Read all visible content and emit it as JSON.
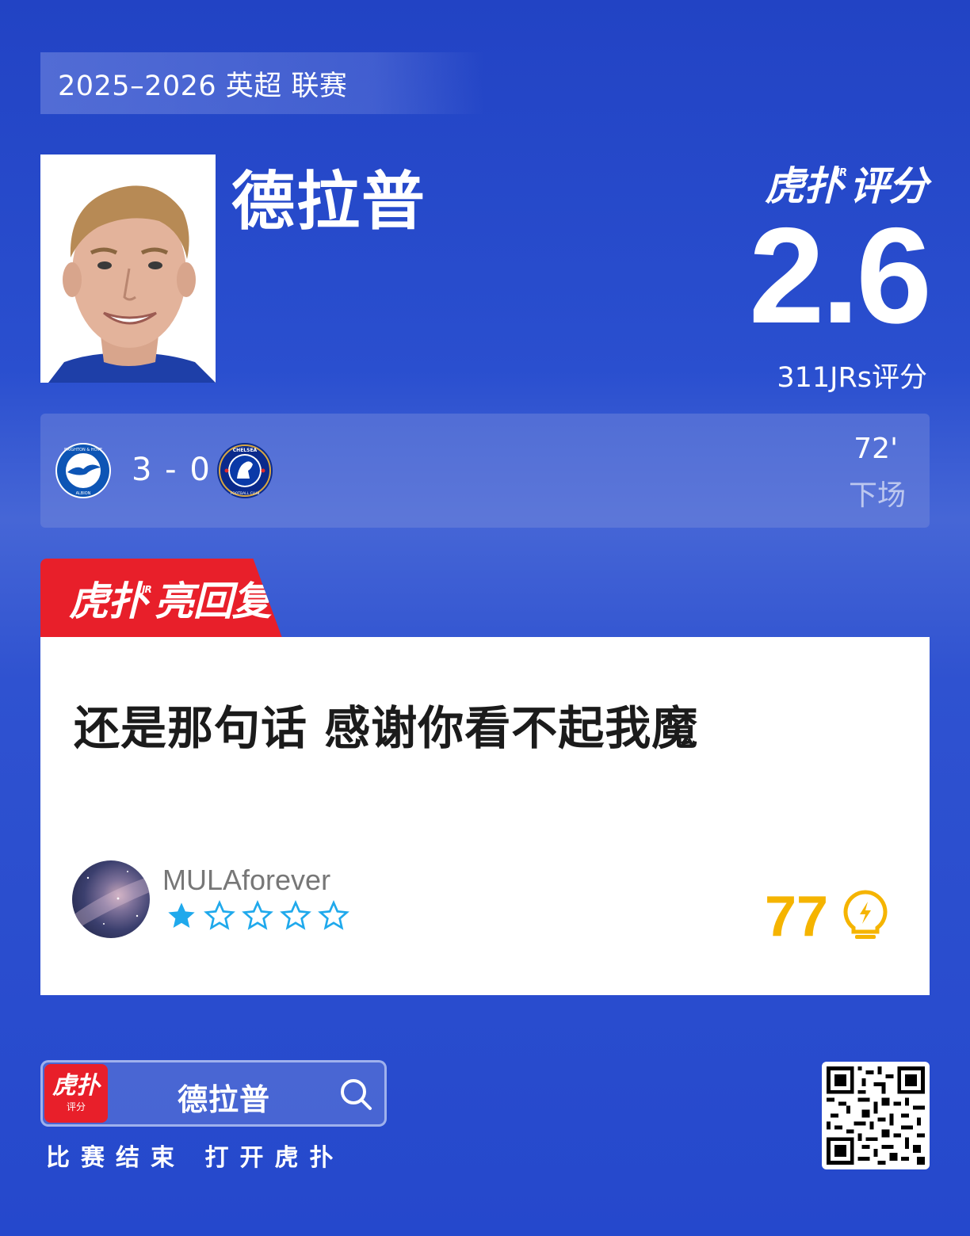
{
  "header": {
    "season": "2025–2026 英超 联赛"
  },
  "player": {
    "name": "德拉普"
  },
  "rating": {
    "brand": "虎扑评分",
    "brand_sup": "JR",
    "score": "2.6",
    "count": "311JRs评分"
  },
  "match": {
    "home_team": "BRIGHTON & HOVE ALBION",
    "away_team": "CHELSEA FOOTBALL CLUB",
    "score": "3 - 0",
    "minute": "72'",
    "status": "下场"
  },
  "hot_reply": {
    "tab_label": "虎扑亮回复",
    "comment": "还是那句话 感谢你看不起我魔",
    "username": "MULAforever",
    "stars_total": 5,
    "stars_filled": 1,
    "likes": "77",
    "colors": {
      "tab": "#e81f2a",
      "star": "#1fa9ec",
      "like": "#f5b400"
    }
  },
  "footer": {
    "app_icon_main": "虎扑",
    "app_icon_sub": "评分",
    "search_query": "德拉普",
    "caption": "比赛结束 打开虎扑"
  }
}
